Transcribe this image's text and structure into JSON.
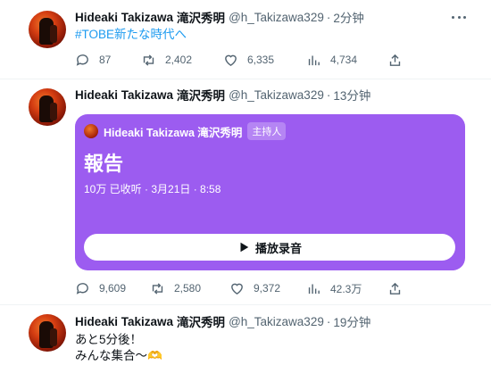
{
  "tweets": [
    {
      "name": "Hideaki Takizawa",
      "name_jp": "滝沢秀明",
      "handle": "@h_Takizawa329",
      "separator": "·",
      "time": "2分钟",
      "line1": "#TOBE新たな時代へ",
      "replies": "87",
      "retweets": "2,402",
      "likes": "6,335",
      "views": "4,734"
    },
    {
      "name": "Hideaki Takizawa",
      "name_jp": "滝沢秀明",
      "handle": "@h_Takizawa329",
      "separator": "·",
      "time": "13分钟",
      "space": {
        "host": "Hideaki Takizawa 滝沢秀明",
        "badge": "主持人",
        "title": "報告",
        "meta": "10万 已收听 · 3月21日 · 8:58",
        "play_label": "播放录音",
        "bg_color": "#9c5cf0"
      },
      "replies": "9,609",
      "retweets": "2,580",
      "likes": "9,372",
      "views": "42.3万"
    },
    {
      "name": "Hideaki Takizawa",
      "name_jp": "滝沢秀明",
      "handle": "@h_Takizawa329",
      "separator": "·",
      "time": "19分钟",
      "line1": "あと5分後！",
      "line2": "みんな集合〜🫶"
    }
  ],
  "icons": {
    "reply": "speech-bubble",
    "retweet": "retweet-arrows",
    "like": "heart",
    "views": "bar-chart",
    "share": "share-upload",
    "more": "three-dots",
    "play": "play-triangle"
  },
  "colors": {
    "text": "#0f1419",
    "secondary": "#536471",
    "link": "#1d9bf0",
    "divider": "#eff3f4"
  }
}
